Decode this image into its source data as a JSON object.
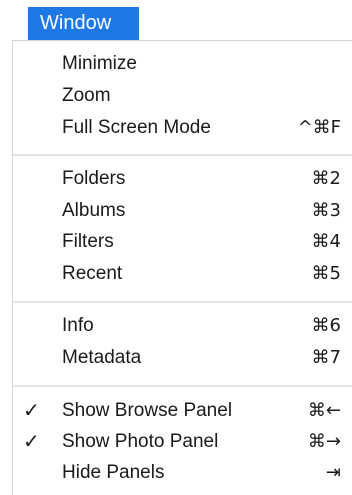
{
  "menubar": {
    "title": "Window"
  },
  "menu": {
    "groups": [
      {
        "items": [
          {
            "label": "Minimize",
            "shortcut": "",
            "checked": ""
          },
          {
            "label": "Zoom",
            "shortcut": "",
            "checked": ""
          },
          {
            "label": "Full Screen Mode",
            "shortcut": "^⌘F",
            "checked": ""
          }
        ]
      },
      {
        "items": [
          {
            "label": "Folders",
            "shortcut": "⌘2",
            "checked": ""
          },
          {
            "label": "Albums",
            "shortcut": "⌘3",
            "checked": ""
          },
          {
            "label": "Filters",
            "shortcut": "⌘4",
            "checked": ""
          },
          {
            "label": "Recent",
            "shortcut": "⌘5",
            "checked": ""
          }
        ]
      },
      {
        "items": [
          {
            "label": "Info",
            "shortcut": "⌘6",
            "checked": ""
          },
          {
            "label": "Metadata",
            "shortcut": "⌘7",
            "checked": ""
          }
        ]
      },
      {
        "items": [
          {
            "label": "Show Browse Panel",
            "shortcut": "⌘←",
            "checked": "✓"
          },
          {
            "label": "Show Photo Panel",
            "shortcut": "⌘→",
            "checked": "✓"
          },
          {
            "label": "Hide Panels",
            "shortcut": "⇥",
            "checked": ""
          }
        ]
      }
    ]
  },
  "colors": {
    "menubar_highlight": "#1e78e6",
    "separator": "#e3e3e3",
    "text": "#1a1a1a"
  }
}
